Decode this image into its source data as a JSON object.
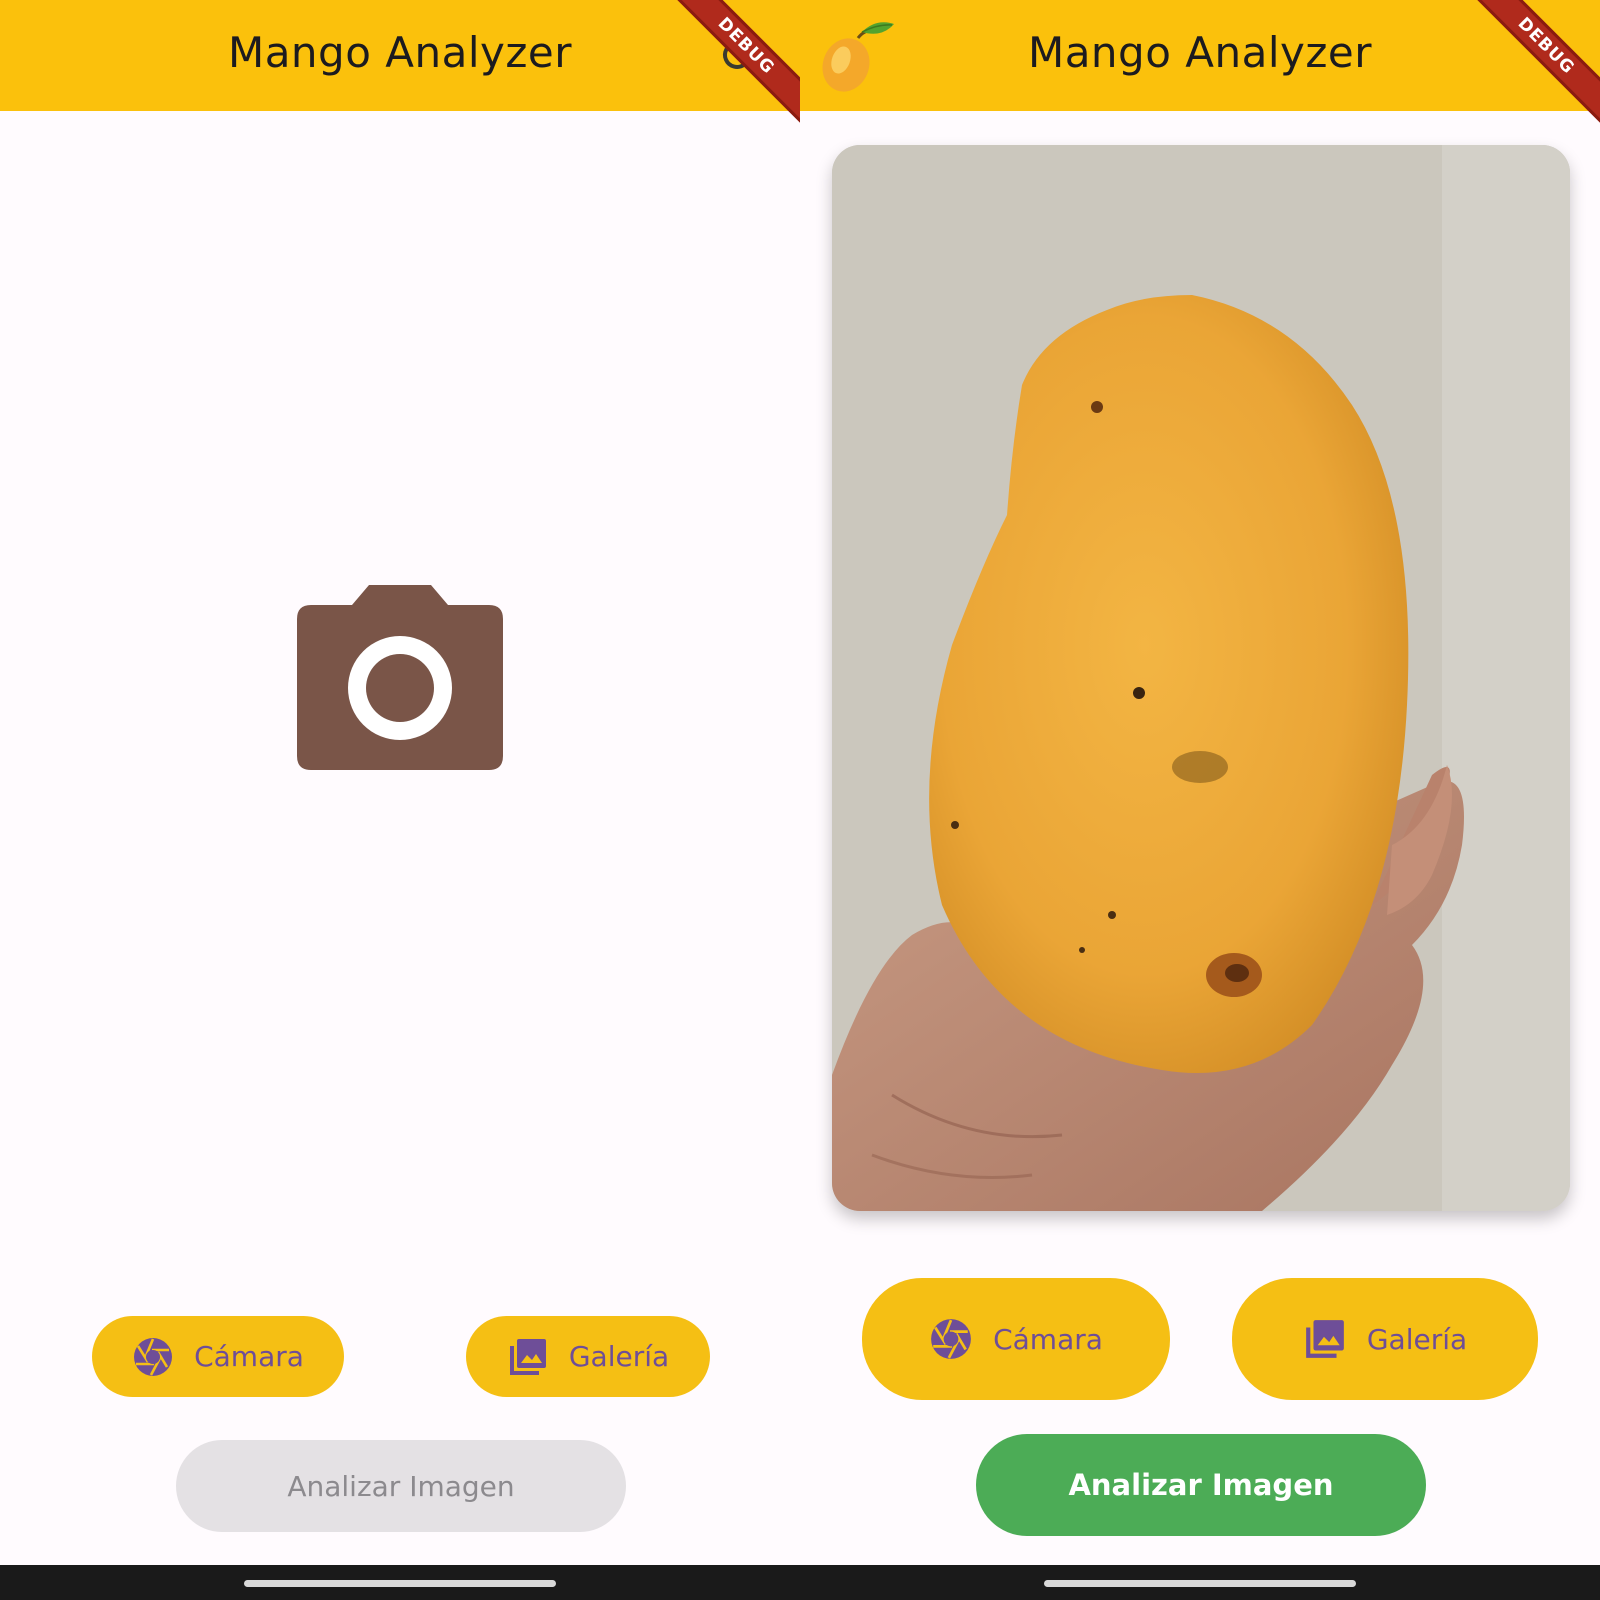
{
  "left_screen": {
    "appbar": {
      "title": "Mango Analyzer",
      "debug_banner": "DEBUG",
      "action_icon": "refresh-icon"
    },
    "placeholder": {
      "icon": "camera-icon"
    },
    "buttons": {
      "camera": {
        "label": "Cámara",
        "icon": "camera-shutter-icon"
      },
      "gallery": {
        "label": "Galería",
        "icon": "photo-library-icon"
      },
      "analyze": {
        "label": "Analizar Imagen",
        "state": "disabled"
      }
    }
  },
  "right_screen": {
    "appbar": {
      "title": "Mango Analyzer",
      "debug_banner": "DEBUG",
      "logo_icon": "mango-icon"
    },
    "image": {
      "content": "photo-of-mango-held-in-hand"
    },
    "buttons": {
      "camera": {
        "label": "Cámara",
        "icon": "camera-shutter-icon"
      },
      "gallery": {
        "label": "Galería",
        "icon": "photo-library-icon"
      },
      "analyze": {
        "label": "Analizar Imagen",
        "state": "enabled"
      }
    }
  },
  "colors": {
    "appbar": "#fbc10c",
    "button": "#f5bf14",
    "button_text": "#6e4e98",
    "placeholder_icon": "#7a5548",
    "analyze_enabled": "#4cac56",
    "analyze_disabled": "#e4e1e4",
    "debug_banner": "#b02a1c"
  }
}
